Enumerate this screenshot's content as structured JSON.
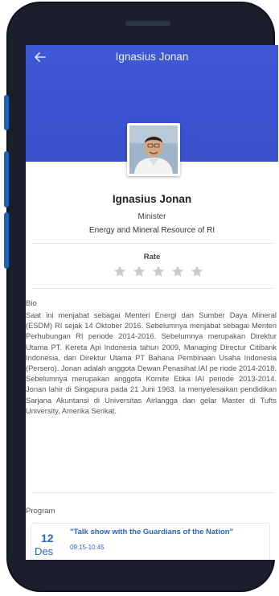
{
  "app_bar": {
    "title": "Ignasius Jonan",
    "back_icon": "arrow-left-icon"
  },
  "profile": {
    "name": "Ignasius Jonan",
    "role": "Minister",
    "organization": "Energy and Mineral Resource of RI"
  },
  "rating": {
    "label": "Rate",
    "stars_total": 5,
    "stars_filled": 0
  },
  "bio": {
    "label": "Bio",
    "text": "Saat ini menjabat sebagai Menteri Energi dan Sumber Daya Mineral (ESDM) RI sejak 14 Oktober 2016. Sebelumnya menjabat sebagai Menteri Perhubungan RI periode 2014-2016. Sebelumnya merupakan Direktur Utama PT. Kereta Api Indonesia tahun 2009, Managing Directur Citibank Indonesia, dan Direktur Utama PT Bahana Pembinaan Usaha Indonesia (Persero). Jonan adalah anggota Dewan Penasihat IAI pe riode 2014-2018. Sebelumnya merupakan anggota Komite Etika IAI periode 2013-2014. Jonan lahir di Singapura pada 21 Juni 1963. Ia menyelesaikan pendidikan Sarjana Akuntansi di Universitas Airlangga dan gelar Master di Tufts University, Amerika Serikat."
  },
  "program": {
    "label": "Program",
    "items": [
      {
        "day": "12",
        "month": "Des",
        "title": "\"Talk show with the Guardians of the Nation\"",
        "time": "09:15-10:45"
      }
    ]
  },
  "colors": {
    "header": "#3a52cf",
    "accent": "#2b64c4",
    "star_empty": "#c9c9c9"
  }
}
